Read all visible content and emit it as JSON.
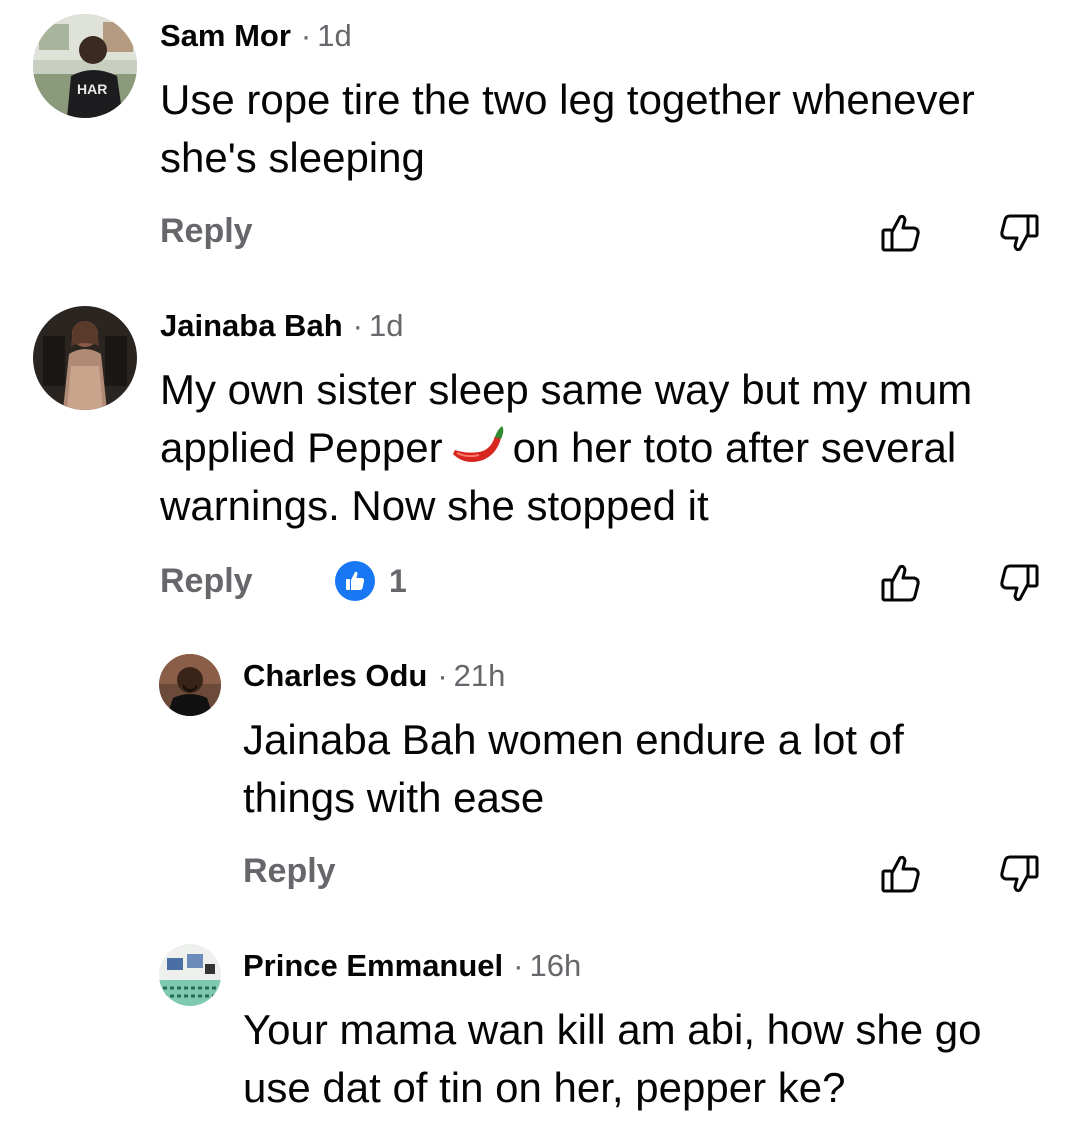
{
  "comments": [
    {
      "author": "Sam Mor",
      "time": "1d",
      "lines": [
        "Use rope tire the two leg together whenever",
        "she's sleeping"
      ],
      "reply_label": "Reply",
      "avatar_text": "HAR"
    },
    {
      "author": "Jainaba Bah",
      "time": "1d",
      "line1": "My own sister sleep same way but my mum",
      "line2_before": "applied Pepper",
      "line2_after": "on her toto after several",
      "line3": "warnings. Now she stopped it",
      "emoji": "hot-pepper-emoji",
      "reply_label": "Reply",
      "reaction_count": "1"
    },
    {
      "author": "Charles Odu",
      "time": "21h",
      "lines": [
        "Jainaba Bah women endure a lot of",
        "things with ease"
      ],
      "reply_label": "Reply"
    },
    {
      "author": "Prince Emmanuel",
      "time": "16h",
      "lines": [
        "Your mama wan kill am abi, how she go",
        "use dat of tin on her, pepper ke?"
      ]
    }
  ],
  "separator": "·",
  "icons": {
    "like": "thumbs-up-icon",
    "dislike": "thumbs-down-icon",
    "reaction": "like-reaction-icon"
  },
  "colors": {
    "text": "#050505",
    "secondary": "#65676b",
    "reaction_blue": "#1877f2",
    "pepper_red": "#d7261f"
  }
}
